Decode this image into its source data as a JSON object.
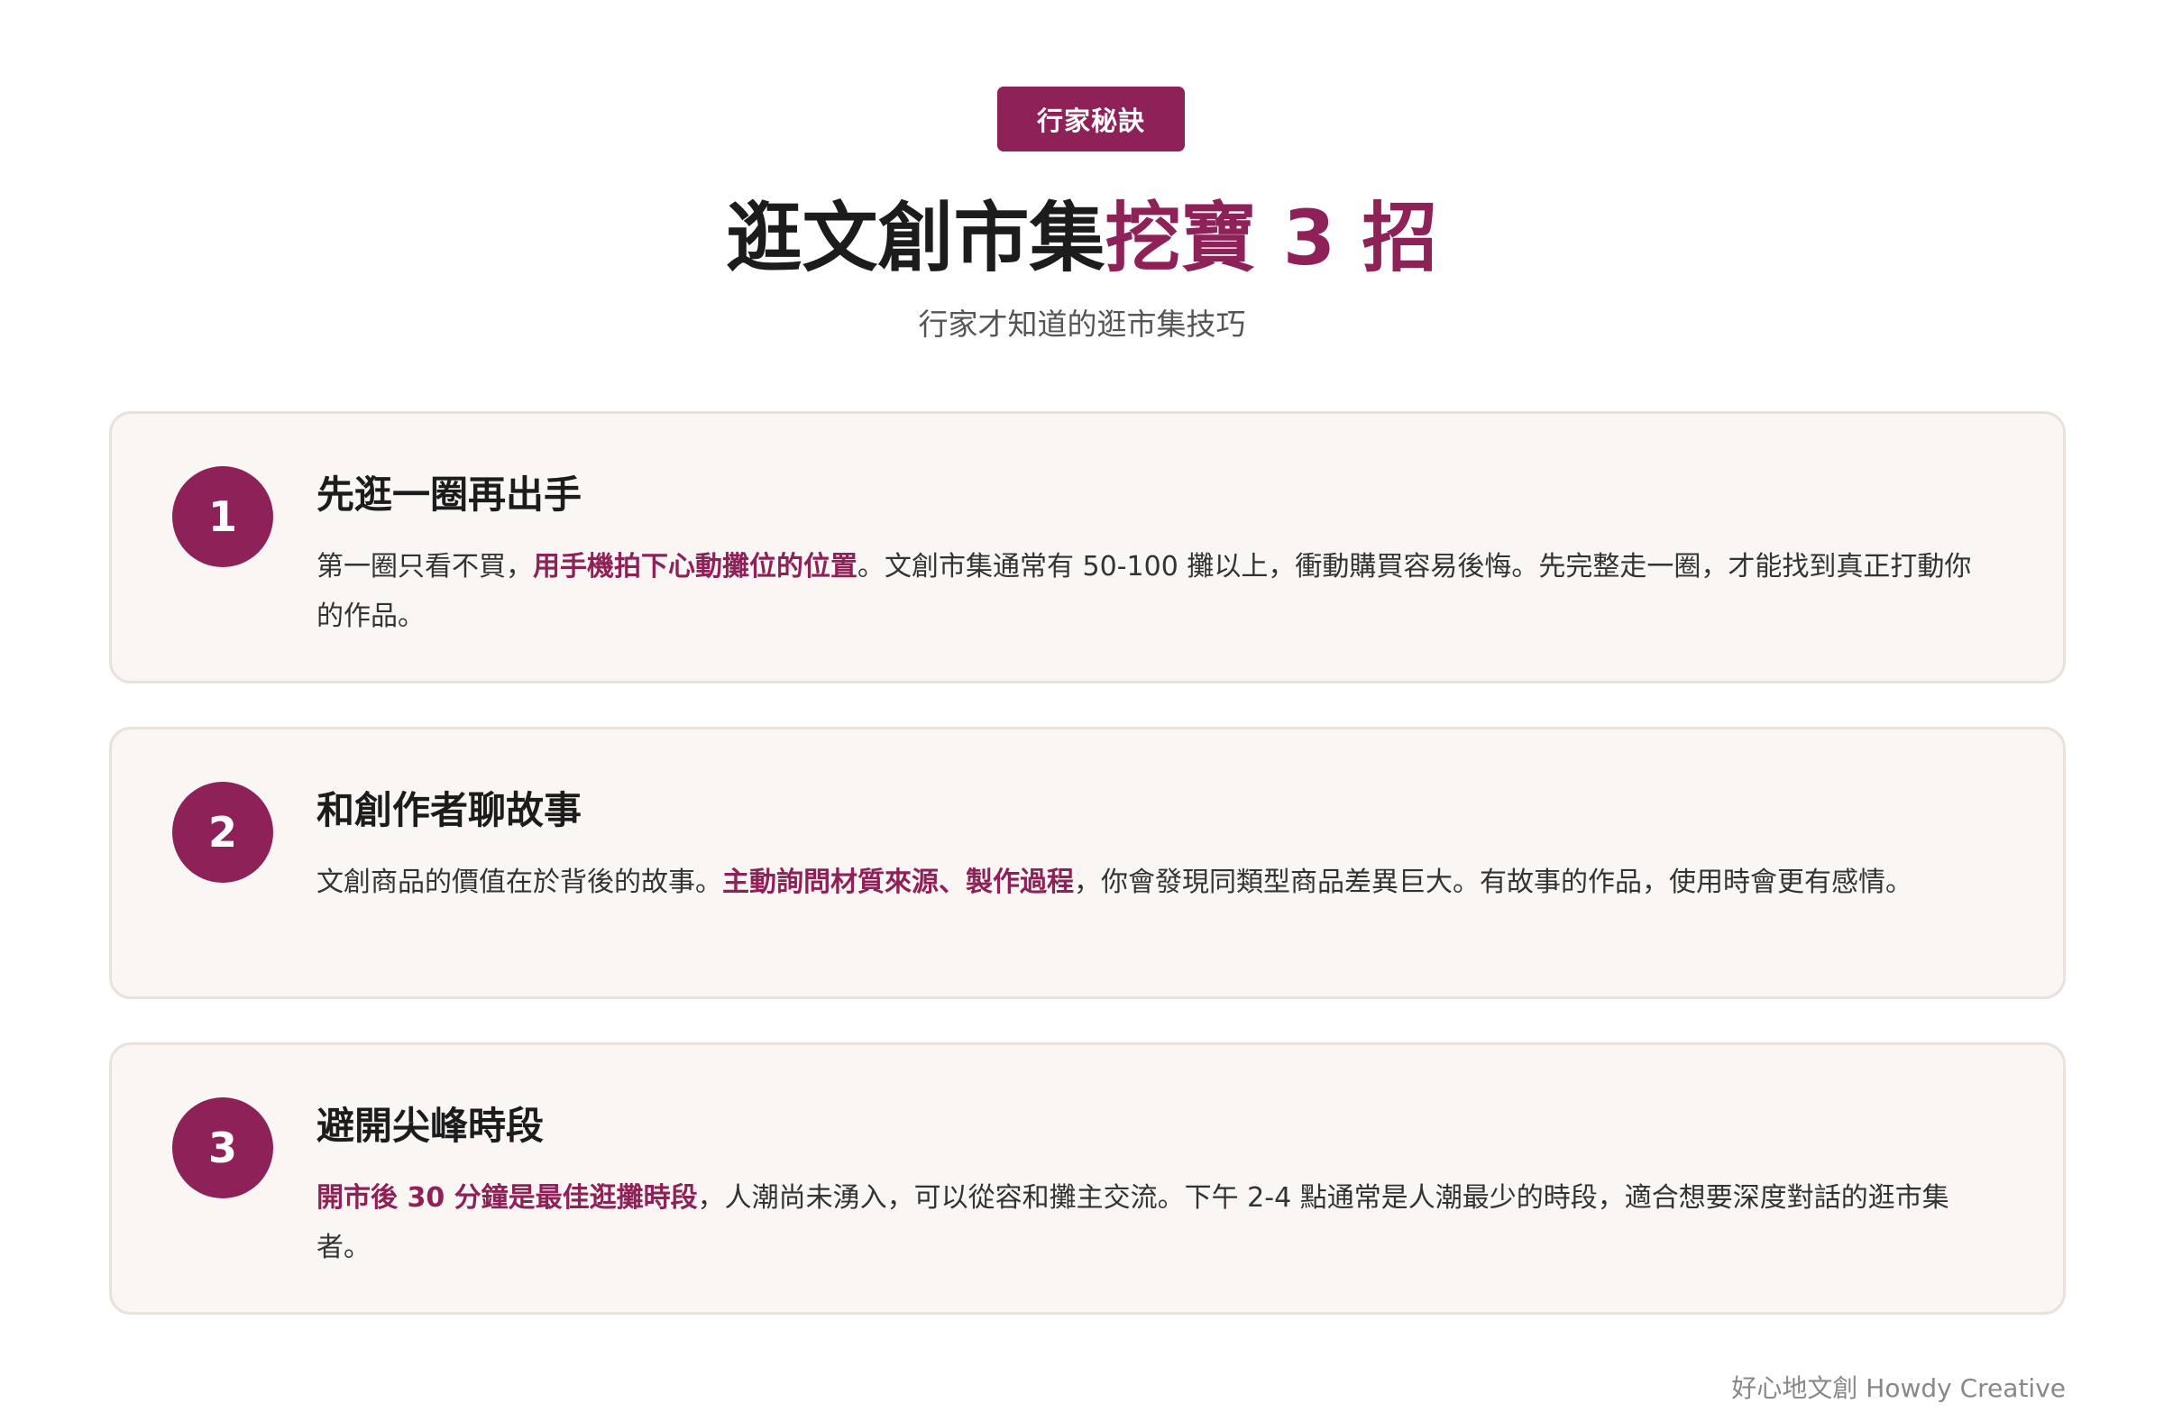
{
  "badge": {
    "label": "行家秘訣"
  },
  "header": {
    "title_main": "逛文創市集",
    "title_accent": "挖寶 3 招",
    "subtitle": "行家才知道的逛市集技巧"
  },
  "tips": [
    {
      "number": "1",
      "title": "先逛一圈再出手",
      "desc_before": "第一圈只看不買，",
      "desc_highlight": "用手機拍下心動攤位的位置",
      "desc_after": "。文創市集通常有 50-100 攤以上，衝動購買容易後悔。先完整走一圈，才能找到真正打動你的作品。"
    },
    {
      "number": "2",
      "title": "和創作者聊故事",
      "desc_before": "文創商品的價值在於背後的故事。",
      "desc_highlight": "主動詢問材質來源、製作過程",
      "desc_after": "，你會發現同類型商品差異巨大。有故事的作品，使用時會更有感情。"
    },
    {
      "number": "3",
      "title": "避開尖峰時段",
      "desc_before": "",
      "desc_highlight": "開市後 30 分鐘是最佳逛攤時段",
      "desc_after": "，人潮尚未湧入，可以從容和攤主交流。下午 2-4 點通常是人潮最少的時段，適合想要深度對話的逛市集者。"
    }
  ],
  "footer": {
    "credit": "好心地文創 Howdy Creative"
  },
  "colors": {
    "accent": "#8e2157",
    "card_bg": "#f9f6f3",
    "card_border": "#e8e2db"
  }
}
